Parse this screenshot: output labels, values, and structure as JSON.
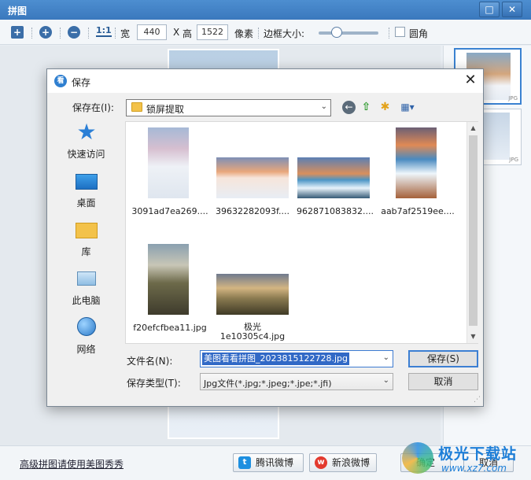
{
  "main": {
    "title": "拼图",
    "window_buttons": {
      "maximize": "□",
      "close": "✕"
    },
    "toolbar": {
      "add_icon": "+",
      "zoom_in_icon": "+",
      "zoom_out_icon": "−",
      "ratio_label": "1:1",
      "width_label": "宽",
      "width_value": "440",
      "x_label": "X",
      "height_label": "高",
      "height_value": "1522",
      "unit_label": "像素",
      "border_label": "边框大小:",
      "round_label": "圆角",
      "round_checked": false
    },
    "thumbnails": [
      {
        "badge": "JPG",
        "selected": true
      },
      {
        "badge": "JPG",
        "selected": false
      }
    ],
    "bottom": {
      "link": "高级拼图请使用美图秀秀",
      "tencent": "腾讯微博",
      "sina": "新浪微博",
      "ok": "确定",
      "cancel": "取消"
    },
    "watermark": {
      "text": "极光下载站",
      "url": "www.xz7.com"
    }
  },
  "dialog": {
    "title": "保存",
    "close_icon": "✕",
    "save_in_label": "保存在(I):",
    "folder": "锁屏提取",
    "places": [
      {
        "label": "快速访问",
        "icon": "star-icon"
      },
      {
        "label": "桌面",
        "icon": "desktop-icon"
      },
      {
        "label": "库",
        "icon": "library-icon"
      },
      {
        "label": "此电脑",
        "icon": "computer-icon"
      },
      {
        "label": "网络",
        "icon": "network-icon"
      }
    ],
    "files": [
      {
        "name": "3091ad7ea269....",
        "pic": "winter-portrait"
      },
      {
        "name": "39632282093f....",
        "pic": "winter-sunset"
      },
      {
        "name": "962871083832....",
        "pic": "waterfall-wide"
      },
      {
        "name": "aab7af2519ee....",
        "pic": "waterfall-portrait"
      },
      {
        "name": "f20efcfbea11.jpg",
        "pic": "village-portrait"
      },
      {
        "name": "极光",
        "name2": "1e10305c4.jpg",
        "pic": "river-sunset"
      }
    ],
    "filename_label": "文件名(N):",
    "filename_value": "美图看看拼图_2023815122728.jpg",
    "filetype_label": "保存类型(T):",
    "filetype_value": "Jpg文件(*.jpg;*.jpeg;*.jpe;*.jfi)",
    "save_button": "保存(S)",
    "cancel_button": "取消"
  }
}
